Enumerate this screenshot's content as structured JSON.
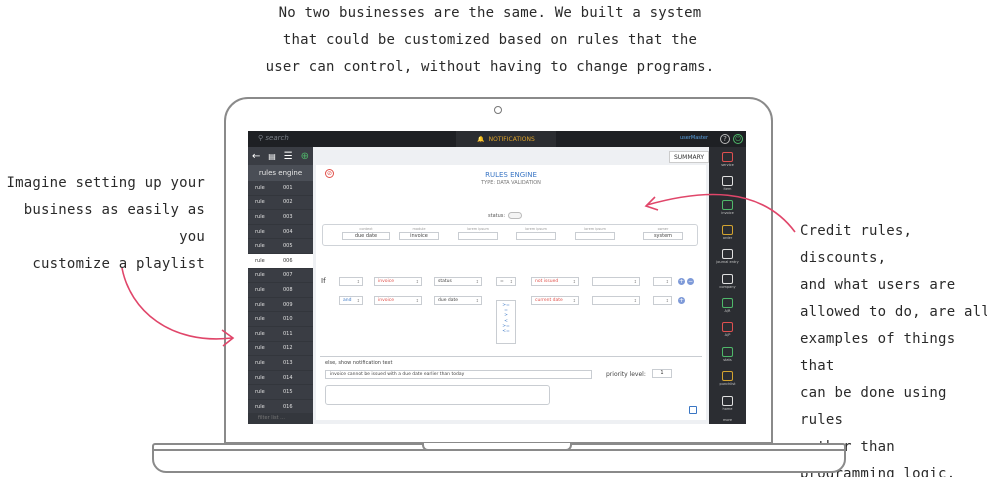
{
  "annotations": {
    "top": [
      "No two businesses are the same. We built a system",
      "that could be customized based on rules that the",
      "user can control, without having to change programs."
    ],
    "left": [
      "Imagine setting up your",
      "business as easily as you",
      "customize a playlist"
    ],
    "right": [
      "Credit rules, discounts,",
      "and what users are",
      "allowed to do, are all",
      "examples of things that",
      "can be done using rules",
      "rather than",
      "programming logic."
    ]
  },
  "topbar": {
    "search_placeholder": "search",
    "notifications_label": "NOTIFICATIONS",
    "user_label": "userMaster"
  },
  "left_panel": {
    "title": "rules engine",
    "rule_label": "rule",
    "rules": [
      "001",
      "002",
      "003",
      "004",
      "005",
      "006",
      "007",
      "008",
      "009",
      "010",
      "011",
      "012",
      "013",
      "014",
      "015",
      "016"
    ],
    "active_index": 5,
    "filter_placeholder": "filter list ..."
  },
  "main": {
    "summary_tab": "SUMMARY",
    "title": "RULES ENGINE",
    "subtitle": "TYPE: DATA VALIDATION",
    "status_label": "status:",
    "context": [
      {
        "label": "context",
        "value": "due date"
      },
      {
        "label": "module",
        "value": "invoice"
      },
      {
        "label": "lorem ipsum",
        "value": ""
      },
      {
        "label": "lorem ipsum",
        "value": ""
      },
      {
        "label": "lorem ipsum",
        "value": ""
      },
      {
        "label": "owner",
        "value": "system"
      }
    ],
    "if_label": "If",
    "row1": {
      "a": "",
      "b": "invoice",
      "c": "status",
      "op": "=",
      "d": "not issued",
      "e": "",
      "f": ""
    },
    "row2": {
      "a": "and",
      "b": "invoice",
      "c": "due date",
      "op": "",
      "d": "current date",
      "e": "",
      "f": ""
    },
    "operators": [
      ">=",
      "=",
      ">",
      "<",
      ">=",
      "<="
    ],
    "else_label": "else, show notification text",
    "notification_text": "invoice cannot be issued with a due date earlier than today",
    "priority_label": "priority level:",
    "priority_value": "1"
  },
  "right_nav": [
    "service",
    "item",
    "invoice",
    "order",
    "journal entry",
    "company",
    "A/R",
    "A/P",
    "stats",
    "punchlist",
    "home",
    "more"
  ],
  "colors": {
    "accent": "#3a76c4",
    "alert": "#e0504a",
    "arrow": "#e0466a"
  }
}
